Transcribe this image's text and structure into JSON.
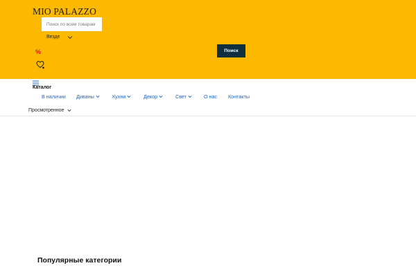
{
  "header": {
    "logo": "MIO PALAZZO",
    "background": "#FDB900",
    "search": {
      "placeholder": "Поиск по всем товарам",
      "scope": "Везде",
      "button_label": "Поиск"
    },
    "sale_icon": "%"
  },
  "catalog": {
    "label": "Каталог"
  },
  "nav": {
    "items": [
      {
        "label": "В наличии",
        "has_dropdown": false
      },
      {
        "label": "Диваны",
        "has_dropdown": true
      },
      {
        "label": "Кухни",
        "has_dropdown": true
      },
      {
        "label": "Декор",
        "has_dropdown": true
      },
      {
        "label": "Свет",
        "has_dropdown": true
      },
      {
        "label": "О нас",
        "has_dropdown": false
      },
      {
        "label": "Контакты",
        "has_dropdown": false
      }
    ],
    "link_color": "#1f64c8"
  },
  "viewed": {
    "label": "Просмотренное"
  },
  "main": {
    "section_title": "Популярные категории"
  }
}
